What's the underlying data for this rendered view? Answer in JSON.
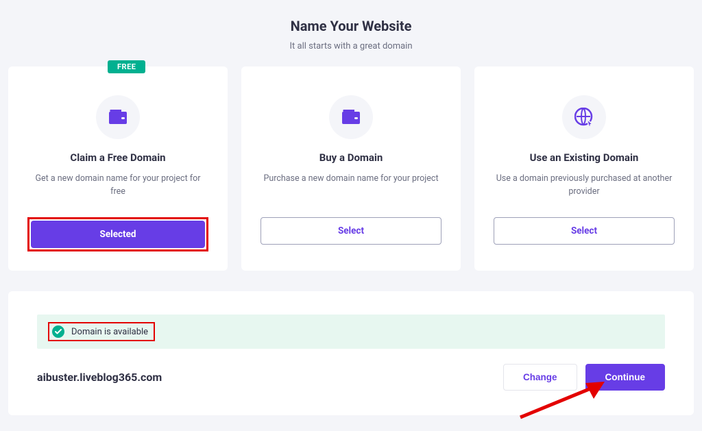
{
  "header": {
    "title": "Name Your Website",
    "subtitle": "It all starts with a great domain"
  },
  "cards": [
    {
      "badge": "FREE",
      "title": "Claim a Free Domain",
      "desc": "Get a new domain name for your project for free",
      "button_label": "Selected",
      "icon": "wallet"
    },
    {
      "badge": null,
      "title": "Buy a Domain",
      "desc": "Purchase a new domain name for your project",
      "button_label": "Select",
      "icon": "wallet"
    },
    {
      "badge": null,
      "title": "Use an Existing Domain",
      "desc": "Use a domain previously purchased at another provider",
      "button_label": "Select",
      "icon": "globe"
    }
  ],
  "availability": {
    "status_text": "Domain is available",
    "domain": "aibuster.liveblog365.com"
  },
  "actions": {
    "change_label": "Change",
    "continue_label": "Continue"
  },
  "colors": {
    "primary": "#673DE6",
    "success": "#00B090",
    "highlight": "#E30000"
  }
}
